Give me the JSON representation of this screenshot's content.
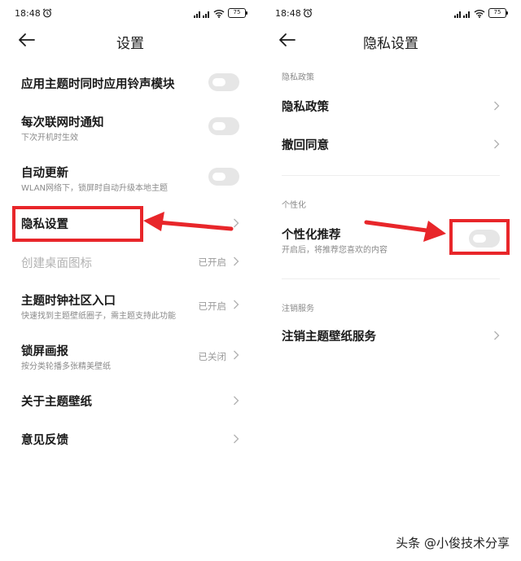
{
  "status": {
    "time": "18:48",
    "battery": "75"
  },
  "left": {
    "title": "设置",
    "items": [
      {
        "title": "应用主题时同时应用铃声模块"
      },
      {
        "title": "每次联网时通知",
        "subtitle": "下次开机时生效"
      },
      {
        "title": "自动更新",
        "subtitle": "WLAN网络下，锁屏时自动升级本地主题"
      },
      {
        "title": "隐私设置"
      },
      {
        "title": "创建桌面图标",
        "value": "已开启"
      },
      {
        "title": "主题时钟社区入口",
        "subtitle": "快速找到主题壁纸圈子，需主题支持此功能",
        "value": "已开启"
      },
      {
        "title": "锁屏画报",
        "subtitle": "按分类轮播多张精美壁纸",
        "value": "已关闭"
      },
      {
        "title": "关于主题壁纸"
      },
      {
        "title": "意见反馈"
      }
    ]
  },
  "right": {
    "title": "隐私设置",
    "sections": [
      {
        "label": "隐私政策",
        "items": [
          {
            "title": "隐私政策"
          },
          {
            "title": "撤回同意"
          }
        ]
      },
      {
        "label": "个性化",
        "items": [
          {
            "title": "个性化推荐",
            "subtitle": "开启后，将推荐您喜欢的内容"
          }
        ]
      },
      {
        "label": "注销服务",
        "items": [
          {
            "title": "注销主题壁纸服务"
          }
        ]
      }
    ]
  },
  "watermark": "头条 @小俊技术分享",
  "colors": {
    "highlight": "#e8262a",
    "toggle_off": "#e6e6e6"
  }
}
